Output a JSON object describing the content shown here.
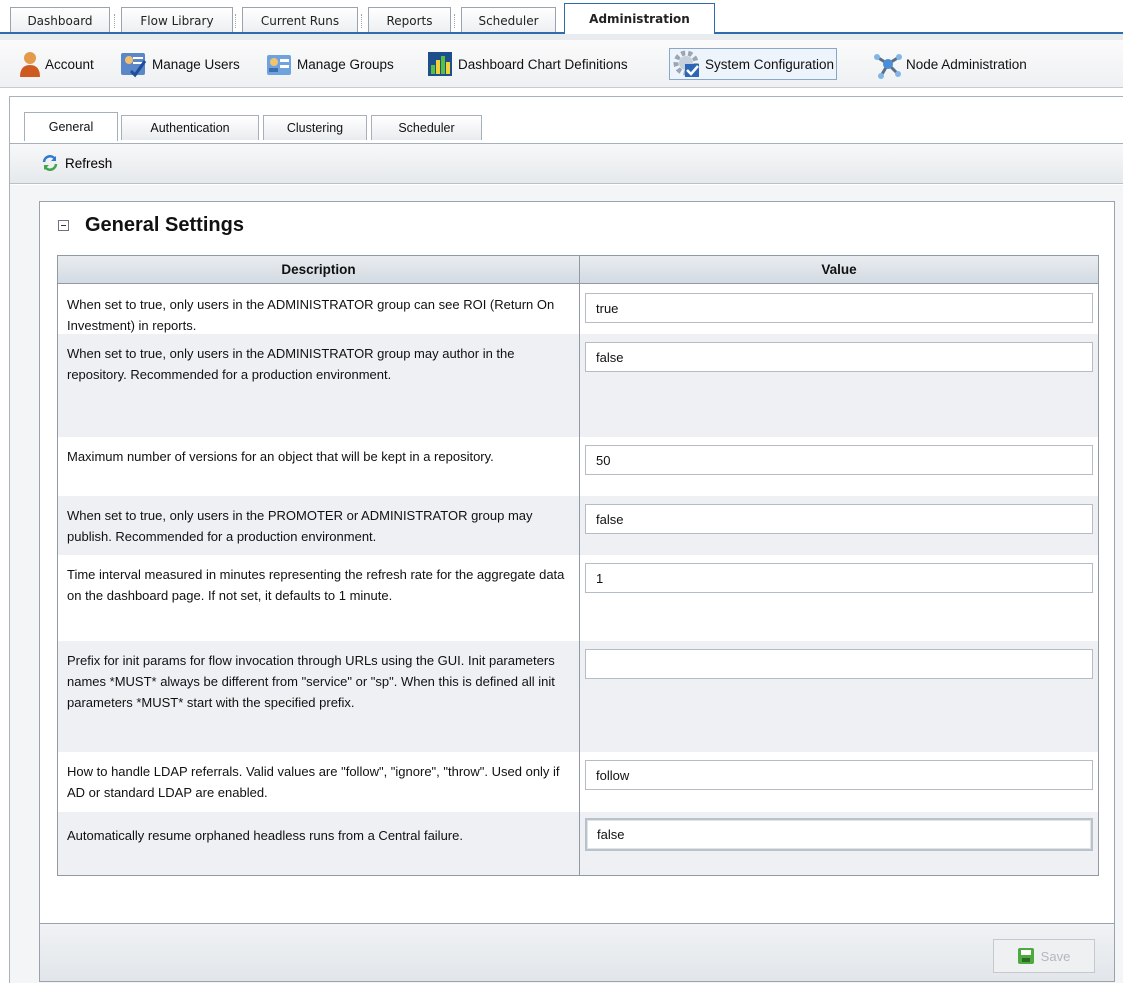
{
  "top_tabs": [
    {
      "label": "Dashboard"
    },
    {
      "label": "Flow Library"
    },
    {
      "label": "Current Runs"
    },
    {
      "label": "Reports"
    },
    {
      "label": "Scheduler"
    },
    {
      "label": "Administration"
    }
  ],
  "active_top_tab": "Administration",
  "sub_toolbar": {
    "items": [
      {
        "label": "Account",
        "icon": "user-icon"
      },
      {
        "label": "Manage Users",
        "icon": "manage-users-icon"
      },
      {
        "label": "Manage Groups",
        "icon": "manage-groups-icon"
      },
      {
        "label": "Dashboard Chart Definitions",
        "icon": "bar-chart-icon"
      },
      {
        "label": "System Configuration",
        "icon": "gear-check-icon"
      },
      {
        "label": "Node Administration",
        "icon": "node-icon"
      }
    ],
    "active": "System Configuration"
  },
  "inner_tabs": [
    {
      "label": "General"
    },
    {
      "label": "Authentication"
    },
    {
      "label": "Clustering"
    },
    {
      "label": "Scheduler"
    }
  ],
  "active_inner_tab": "General",
  "refresh_label": "Refresh",
  "section": {
    "title": "General Settings",
    "columns": {
      "description": "Description",
      "value": "Value"
    },
    "rows": [
      {
        "description": "When set to true, only users in the ADMINISTRATOR group can see ROI (Return On Investment) in reports.",
        "value": "true"
      },
      {
        "description": "When set to true, only users in the ADMINISTRATOR group may author in the repository. Recommended for a production environment.",
        "value": "false"
      },
      {
        "description": "Maximum number of versions for an object that will be kept in a repository.",
        "value": "50"
      },
      {
        "description": "When set to true, only users in the PROMOTER or ADMINISTRATOR group may publish. Recommended for a production environment.",
        "value": "false"
      },
      {
        "description": "Time interval measured in minutes representing the refresh rate for the aggregate data on the dashboard page. If not set, it defaults to 1 minute.",
        "value": "1"
      },
      {
        "description": "Prefix for init params for flow invocation through URLs using the GUI. Init parameters names *MUST* always be different from \"service\" or \"sp\". When this is defined all init parameters *MUST* start with the specified prefix.",
        "value": ""
      },
      {
        "description": "How to handle LDAP referrals. Valid values are \"follow\", \"ignore\", \"throw\". Used only if AD or standard LDAP are enabled.",
        "value": "follow"
      },
      {
        "description": "Automatically resume orphaned headless runs from a Central failure.",
        "value": "false"
      }
    ]
  },
  "save_label": "Save"
}
